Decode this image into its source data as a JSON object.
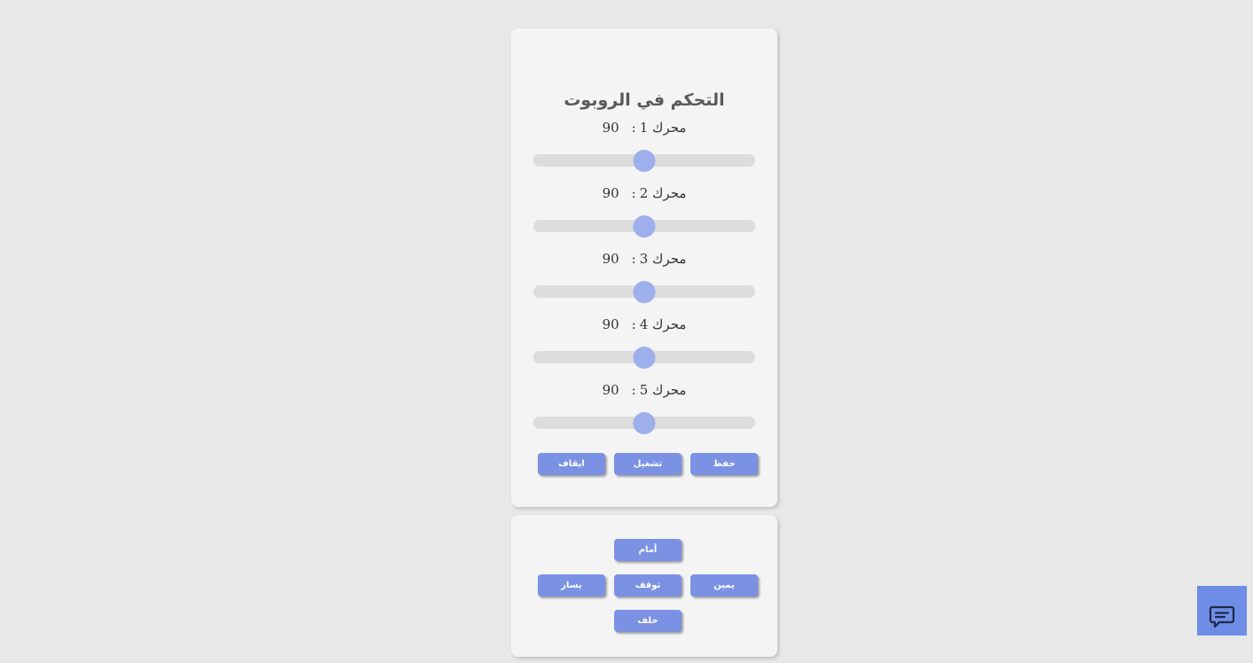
{
  "control_panel": {
    "title": "التحكم في الروبوت",
    "motors": [
      {
        "label": "محرك 1",
        "colon": ":",
        "value": 90,
        "slider_fraction": 0.5
      },
      {
        "label": "محرك 2",
        "colon": ":",
        "value": 90,
        "slider_fraction": 0.5
      },
      {
        "label": "محرك 3",
        "colon": ":",
        "value": 90,
        "slider_fraction": 0.5
      },
      {
        "label": "محرك 4",
        "colon": ":",
        "value": 90,
        "slider_fraction": 0.5
      },
      {
        "label": "محرك 5",
        "colon": ":",
        "value": 90,
        "slider_fraction": 0.5
      }
    ],
    "buttons": {
      "save": "حفظ",
      "run": "تشغيل",
      "stop": "ايقاف"
    }
  },
  "drive_panel": {
    "forward": "أمام",
    "right": "يمين",
    "halt": "توقف",
    "left": "يسار",
    "backward": "خلف"
  },
  "chat_button": {
    "icon": "chat-icon"
  },
  "colors": {
    "accent": "#7b92e4",
    "slider_thumb": "#9db0ec",
    "panel_bg": "#f4f4f4",
    "page_bg": "#e8e8e8"
  }
}
